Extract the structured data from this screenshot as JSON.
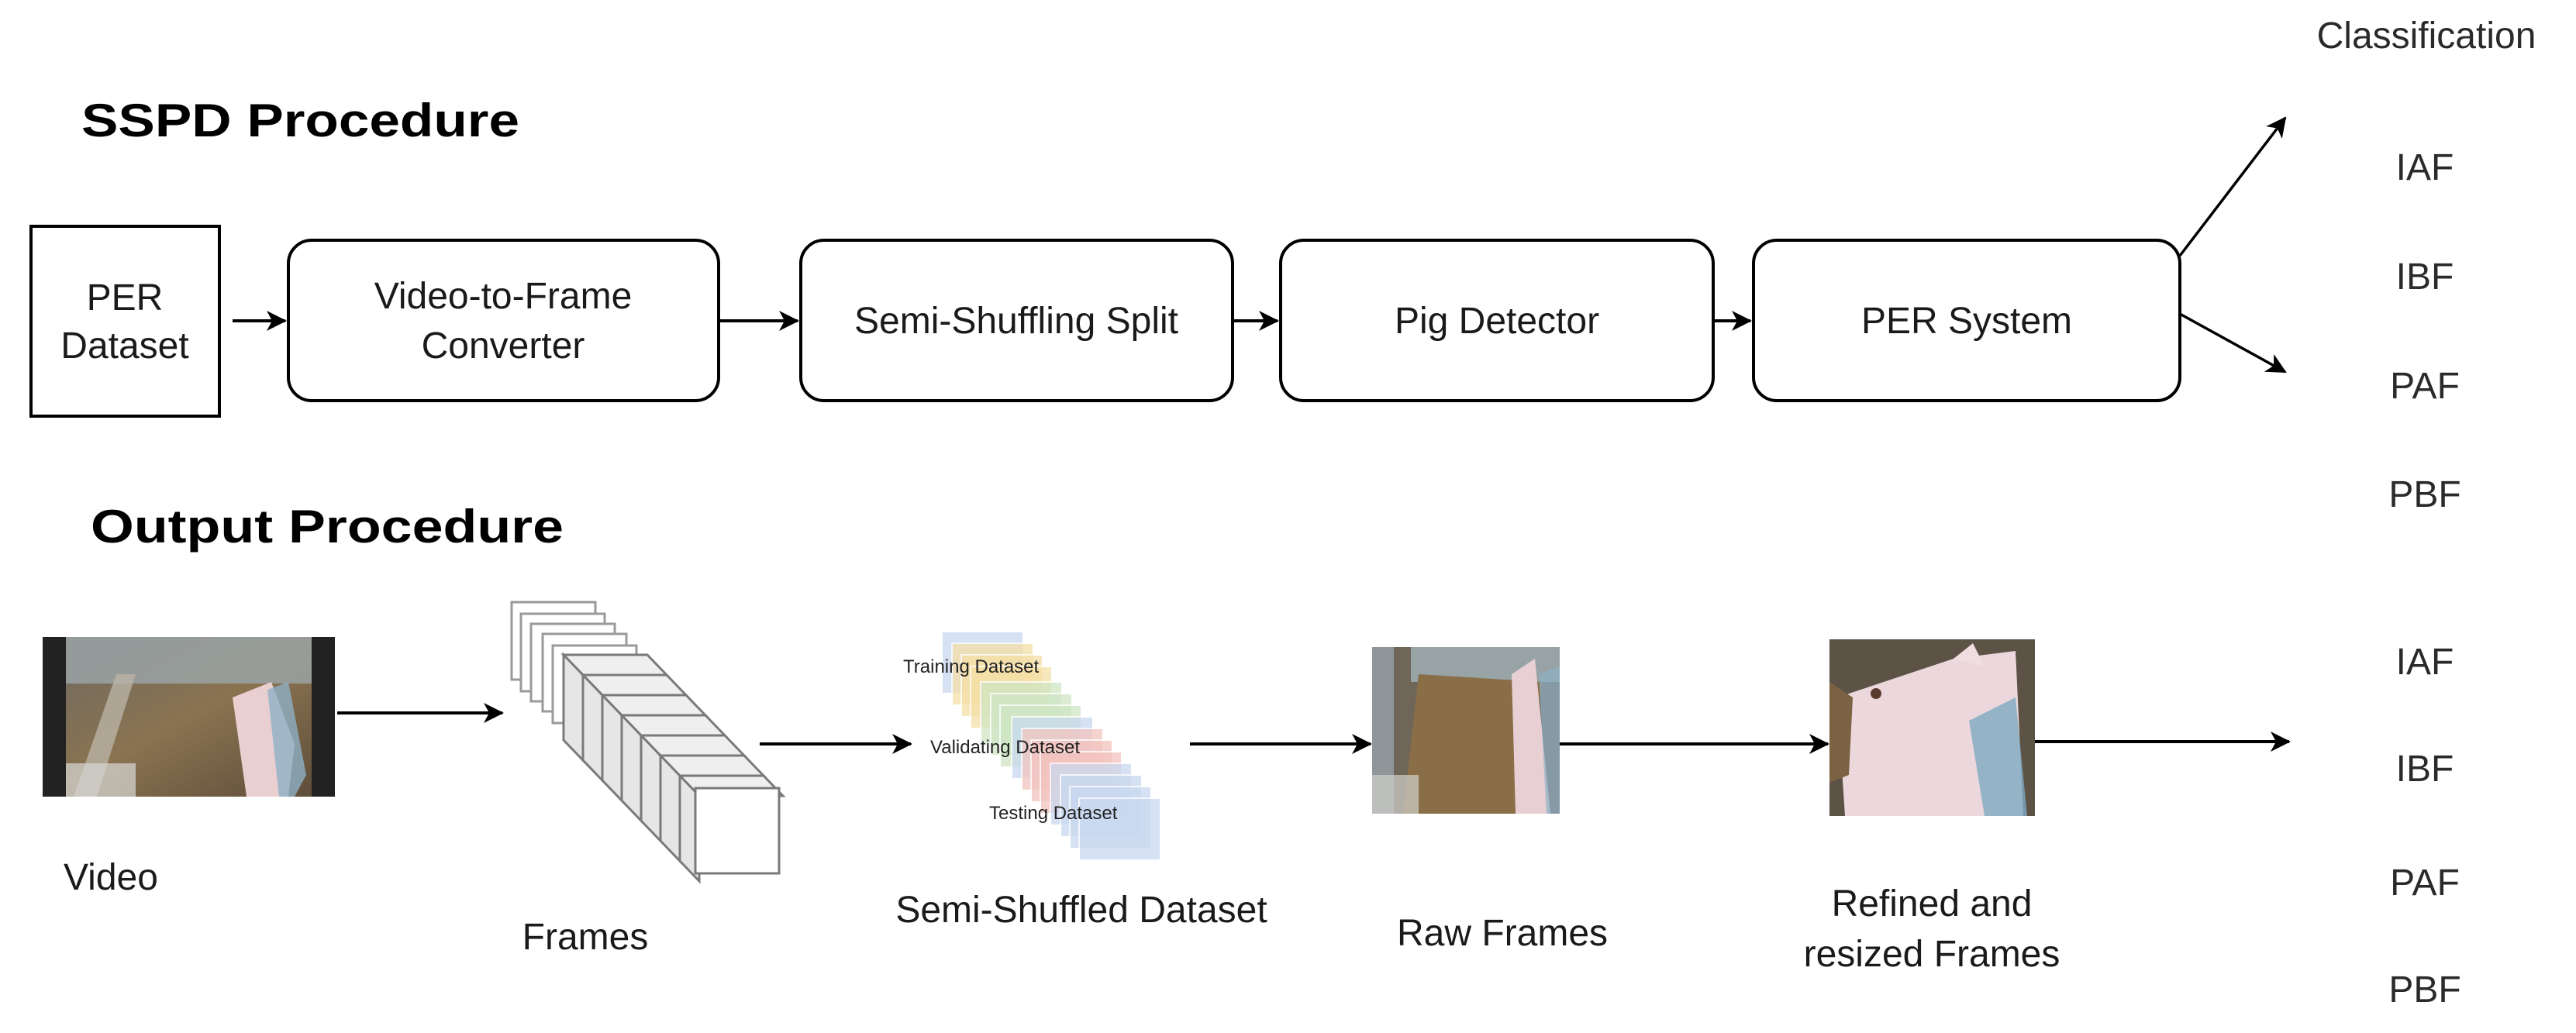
{
  "sspd": {
    "title": "SSPD  Procedure",
    "steps": [
      {
        "lines": [
          "PER",
          "Dataset"
        ]
      },
      {
        "lines": [
          "Video-to-Frame",
          "Converter"
        ]
      },
      {
        "lines": [
          "Semi-Shuffling Split"
        ]
      },
      {
        "lines": [
          "Pig Detector"
        ]
      },
      {
        "lines": [
          "PER System"
        ]
      }
    ],
    "classification_header": "Classification",
    "classes": [
      "IAF",
      "IBF",
      "PAF",
      "PBF"
    ]
  },
  "output": {
    "title": "Output  Procedure",
    "video_label": "Video",
    "frames_label": "Frames",
    "dataset_label": "Semi-Shuffled Dataset",
    "dataset_parts": {
      "training": "Training Dataset",
      "validating": "Validating Dataset",
      "testing": "Testing Dataset"
    },
    "raw_label": "Raw Frames",
    "refined_label_lines": [
      "Refined and",
      "resized Frames"
    ],
    "classes": [
      "IAF",
      "IBF",
      "PAF",
      "PBF"
    ]
  },
  "colors": {
    "training": "#f5dfa6",
    "training_back": "#c9d9ef",
    "validating_green": "#cfe6c4",
    "validating_red": "#f3c4c0",
    "testing": "#c9d9f0"
  }
}
